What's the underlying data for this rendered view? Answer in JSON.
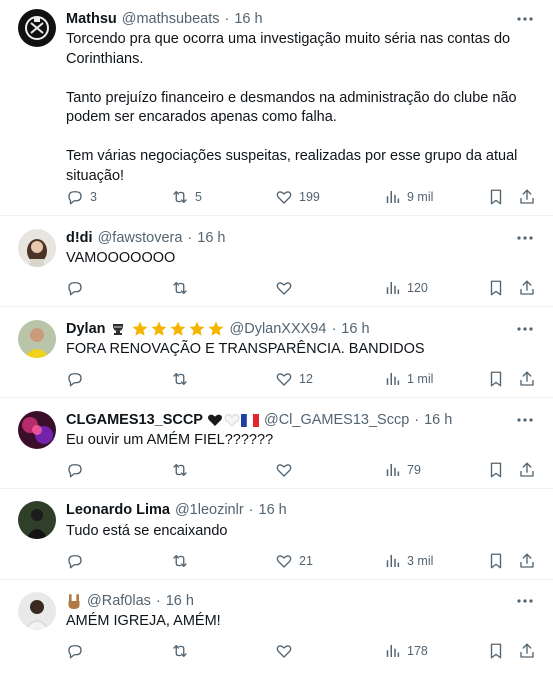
{
  "tweets": [
    {
      "name": "Mathsu",
      "handle": "@mathsubeats",
      "dot": "·",
      "time": "16 h",
      "badges": [],
      "text": [
        "Torcendo pra que ocorra uma investigação muito séria nas contas do Corinthians.",
        "Tanto prejuízo financeiro e desmandos na administração do clube não podem ser encarados apenas como falha.",
        "Tem várias negociações suspeitas, realizadas por esse grupo da atual situação!"
      ],
      "replies": "3",
      "reposts": "5",
      "likes": "199",
      "views": "9 mil"
    },
    {
      "name": "d!di",
      "handle": "@fawstovera",
      "dot": "·",
      "time": "16 h",
      "badges": [],
      "text": [
        "VAMOOOOOOO"
      ],
      "replies": "",
      "reposts": "",
      "likes": "",
      "views": "120"
    },
    {
      "name": "Dylan",
      "handle": "@DylanXXX94",
      "dot": "·",
      "time": "16 h",
      "badges": [
        "trophy-emoji",
        "star-emoji",
        "star-emoji",
        "star-emoji",
        "star-emoji",
        "star-emoji"
      ],
      "text": [
        "FORA RENOVAÇÃO E TRANSPARÊNCIA. BANDIDOS"
      ],
      "replies": "",
      "reposts": "",
      "likes": "12",
      "views": "1 mil"
    },
    {
      "name": "CLGAMES13_SCCP",
      "handle": "@Cl_GAMES13_Sccp",
      "dot": "·",
      "time": "16 h",
      "badges": [
        "black-heart-emoji",
        "white-heart-emoji",
        "france-flag-emoji"
      ],
      "text": [
        "Eu ouvir um AMÉM FIEL??????"
      ],
      "replies": "",
      "reposts": "",
      "likes": "",
      "views": "79"
    },
    {
      "name": "Leonardo Lima",
      "handle": "@1leozinlr",
      "dot": "·",
      "time": "16 h",
      "badges": [],
      "text": [
        "Tudo está se encaixando"
      ],
      "replies": "",
      "reposts": "",
      "likes": "21",
      "views": "3 mil"
    },
    {
      "name": "",
      "handle": "@Raf0las",
      "dot": "·",
      "time": "16 h",
      "badges": [
        "rock-hand-emoji"
      ],
      "text": [
        "AMÉM IGREJA, AMÉM!"
      ],
      "replies": "",
      "reposts": "",
      "likes": "",
      "views": "178"
    }
  ],
  "colors": {
    "text": "#0f1419",
    "secondary": "#536471",
    "divider": "#eff3f4",
    "star": "#f4b400"
  },
  "icons": {
    "more": "more-dots-icon",
    "reply": "reply-icon",
    "repost": "repost-icon",
    "like": "like-icon",
    "views": "views-icon",
    "bookmark": "bookmark-icon",
    "share": "share-icon"
  }
}
